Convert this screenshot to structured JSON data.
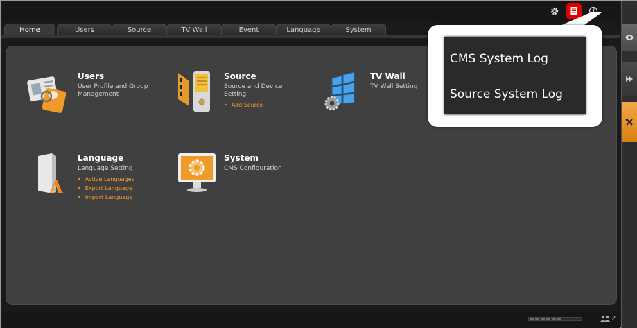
{
  "tabs": [
    {
      "label": "Home",
      "active": true
    },
    {
      "label": "Users"
    },
    {
      "label": "Source"
    },
    {
      "label": "TV Wall"
    },
    {
      "label": "Event"
    },
    {
      "label": "Language"
    },
    {
      "label": "System"
    }
  ],
  "toolbar": {
    "icons": [
      "gear-icon",
      "log-document-icon",
      "info-icon"
    ]
  },
  "modules": {
    "users": {
      "title": "Users",
      "desc": "User Profile and Group Management",
      "icon": "user-id-card-icon"
    },
    "source": {
      "title": "Source",
      "desc": "Source and Device Setting",
      "links": [
        "Add Source"
      ],
      "icon": "source-device-icon"
    },
    "tvwall": {
      "title": "TV Wall",
      "desc": "TV Wall Setting",
      "icon": "tv-wall-icon"
    },
    "language": {
      "title": "Language",
      "desc": "Language Setting",
      "links": [
        "Active Languages",
        "Export Language",
        "Import Language"
      ],
      "icon": "language-folder-icon"
    },
    "system": {
      "title": "System",
      "desc": "CMS Configuration",
      "icon": "system-monitor-icon"
    }
  },
  "log_menu": {
    "items": [
      "CMS System Log",
      "Source System Log"
    ]
  },
  "status": {
    "user_count": "2"
  },
  "colors": {
    "accent": "#f0a030",
    "highlight": "#e00000",
    "panel": "#404040"
  }
}
